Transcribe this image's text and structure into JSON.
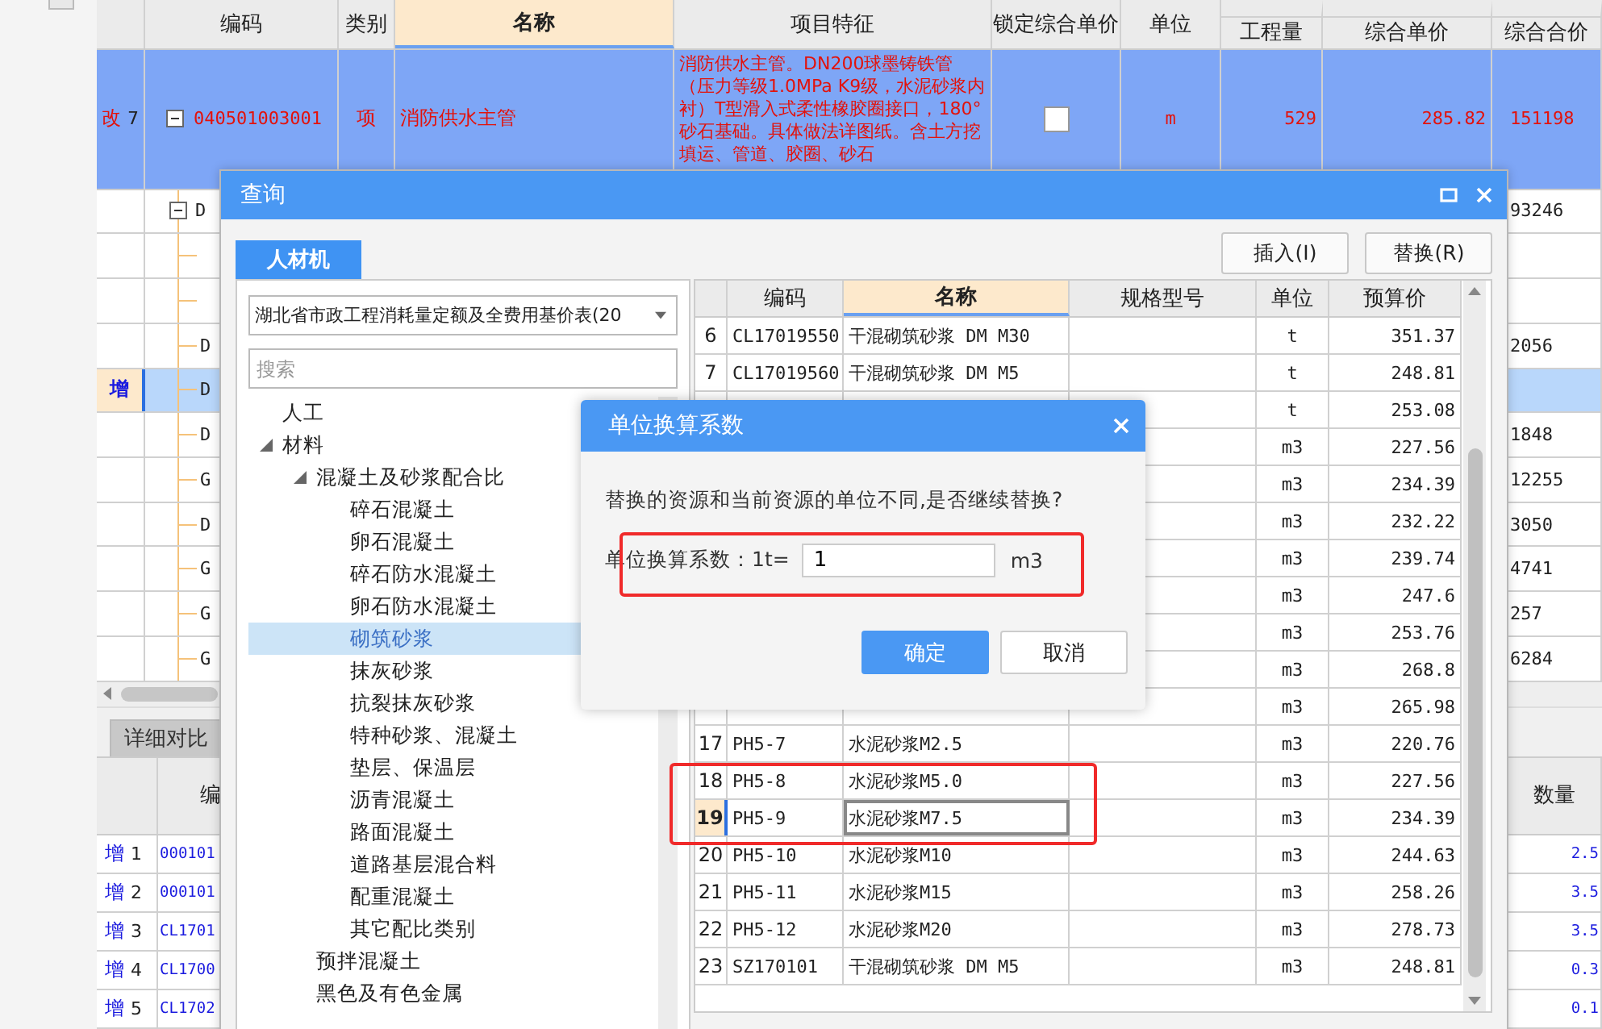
{
  "app_table": {
    "columns": [
      {
        "label": "编码",
        "selected": false
      },
      {
        "label": "类别",
        "selected": false
      },
      {
        "label": "名称",
        "selected": true
      },
      {
        "label": "项目特征",
        "selected": false
      },
      {
        "label": "锁定综合单价",
        "selected": false
      },
      {
        "label": "单位",
        "selected": false
      },
      {
        "label": "工程量",
        "selected": false
      },
      {
        "label": "综合单价",
        "selected": false
      },
      {
        "label": "综合合价",
        "selected": false
      }
    ],
    "current_row": {
      "mark": "改",
      "num": "7",
      "code": "040501003001",
      "type": "项",
      "name": "消防供水主管",
      "features": "消防供水主管。DN200球墨铸铁管（压力等级1.0MPa K9级，水泥砂浆内衬）T型滑入式柔性橡胶圈接口，180° 砂石基础。具体做法详图纸。含土方挖填运、管道、胶圈、砂石",
      "locked": false,
      "unit": "m",
      "quantity": "529",
      "unit_price": "285.82",
      "total": "151198"
    },
    "rows": [
      {
        "kind": "group",
        "code": "D",
        "total": "93246",
        "selected": false
      },
      {
        "kind": "item",
        "selected": false
      },
      {
        "kind": "item",
        "selected": false
      },
      {
        "kind": "item",
        "code": "D",
        "total": "2056",
        "selected": false
      },
      {
        "kind": "item",
        "mark": "增",
        "code": "D",
        "selected": true
      },
      {
        "kind": "item",
        "code": "D",
        "total": "1848",
        "selected": false
      },
      {
        "kind": "item",
        "code": "G",
        "total": "12255",
        "selected": false
      },
      {
        "kind": "item",
        "code": "D",
        "total": "3050",
        "selected": false
      },
      {
        "kind": "item",
        "code": "G",
        "total": "4741",
        "selected": false
      },
      {
        "kind": "item",
        "code": "G",
        "total": "257",
        "selected": false
      },
      {
        "kind": "item",
        "code": "G",
        "total": "6284",
        "selected": false
      }
    ]
  },
  "detail_panel": {
    "tabs": [
      {
        "label": "详细对比",
        "selected": true
      }
    ],
    "columns": [
      "编",
      "数量"
    ],
    "rows": [
      {
        "mark": "增",
        "num": "1",
        "code": "000101",
        "quantity": "2.5"
      },
      {
        "mark": "增",
        "num": "2",
        "code": "000101",
        "quantity": "3.5"
      },
      {
        "mark": "增",
        "num": "3",
        "code": "CL1701",
        "quantity": "3.5"
      },
      {
        "mark": "增",
        "num": "4",
        "code": "CL1700",
        "quantity": "0.3"
      },
      {
        "mark": "增",
        "num": "5",
        "code": "CL1702",
        "quantity": "0.1"
      }
    ]
  },
  "query_dialog": {
    "title": "查询",
    "tabs": [
      {
        "label": "人材机",
        "selected": true
      }
    ],
    "buttons": [
      "插入(I)",
      "替换(R)"
    ],
    "library": "湖北省市政工程消耗量定额及全费用基价表(20",
    "search": {
      "placeholder": "搜索"
    },
    "tree": [
      {
        "label": "人工",
        "selected": false
      },
      {
        "label": "材料",
        "selected": false,
        "expanded": true,
        "children": [
          {
            "label": "混凝土及砂浆配合比",
            "selected": false,
            "expanded": true,
            "children": [
              {
                "label": "碎石混凝土",
                "selected": false
              },
              {
                "label": "卵石混凝土",
                "selected": false
              },
              {
                "label": "碎石防水混凝土",
                "selected": false
              },
              {
                "label": "卵石防水混凝土",
                "selected": false
              },
              {
                "label": "砌筑砂浆",
                "selected": true
              },
              {
                "label": "抹灰砂浆",
                "selected": false
              },
              {
                "label": "抗裂抹灰砂浆",
                "selected": false
              },
              {
                "label": "特种砂浆、混凝土",
                "selected": false
              },
              {
                "label": "垫层、保温层",
                "selected": false
              },
              {
                "label": "沥青混凝土",
                "selected": false
              },
              {
                "label": "路面混凝土",
                "selected": false
              },
              {
                "label": "道路基层混合料",
                "selected": false
              },
              {
                "label": "配重混凝土",
                "selected": false
              },
              {
                "label": "其它配比类别",
                "selected": false
              }
            ]
          },
          {
            "label": "预拌混凝土",
            "selected": false
          },
          {
            "label": "黑色及有色金属",
            "selected": false
          }
        ]
      }
    ],
    "table": {
      "columns": [
        {
          "label": "编码",
          "selected": false
        },
        {
          "label": "名称",
          "selected": true
        },
        {
          "label": "规格型号",
          "selected": false
        },
        {
          "label": "单位",
          "selected": false
        },
        {
          "label": "预算价",
          "selected": false
        }
      ],
      "rows": [
        {
          "num": "6",
          "code": "CL17019550",
          "name": "干混砌筑砂浆 DM M30",
          "unit": "t",
          "price": "351.37",
          "selected": false
        },
        {
          "num": "7",
          "code": "CL17019560",
          "name": "干混砌筑砂浆 DM M5",
          "unit": "t",
          "price": "248.81",
          "selected": false
        },
        {
          "unit": "t",
          "price": "253.08"
        },
        {
          "unit": "m3",
          "price": "227.56"
        },
        {
          "unit": "m3",
          "price": "234.39"
        },
        {
          "unit": "m3",
          "price": "232.22"
        },
        {
          "unit": "m3",
          "price": "239.74"
        },
        {
          "unit": "m3",
          "price": "247.6"
        },
        {
          "unit": "m3",
          "price": "253.76"
        },
        {
          "unit": "m3",
          "price": "268.8"
        },
        {
          "unit": "m3",
          "price": "265.98"
        },
        {
          "num": "17",
          "code": "PH5-7",
          "name": "水泥砂浆M2.5",
          "unit": "m3",
          "price": "220.76",
          "selected": false
        },
        {
          "num": "18",
          "code": "PH5-8",
          "name": "水泥砂浆M5.0",
          "unit": "m3",
          "price": "227.56",
          "selected": false
        },
        {
          "num": "19",
          "code": "PH5-9",
          "name": "水泥砂浆M7.5",
          "unit": "m3",
          "price": "234.39",
          "selected": true
        },
        {
          "num": "20",
          "code": "PH5-10",
          "name": "水泥砂浆M10",
          "unit": "m3",
          "price": "244.63",
          "selected": false
        },
        {
          "num": "21",
          "code": "PH5-11",
          "name": "水泥砂浆M15",
          "unit": "m3",
          "price": "258.26",
          "selected": false
        },
        {
          "num": "22",
          "code": "PH5-12",
          "name": "水泥砂浆M20",
          "unit": "m3",
          "price": "278.73",
          "selected": false
        },
        {
          "num": "23",
          "code": "SZ170101",
          "name": "干混砌筑砂浆 DM M5",
          "unit": "m3",
          "price": "248.81",
          "selected": false
        }
      ]
    }
  },
  "unit_dialog": {
    "title": "单位换算系数",
    "message": "替换的资源和当前资源的单位不同,是否继续替换?",
    "factor_label": "单位换算系数：1t=",
    "factor_value": "1",
    "target_unit": "m3",
    "buttons": [
      {
        "label": "确定",
        "kind": "primary"
      },
      {
        "label": "取消",
        "kind": "secondary"
      }
    ]
  }
}
